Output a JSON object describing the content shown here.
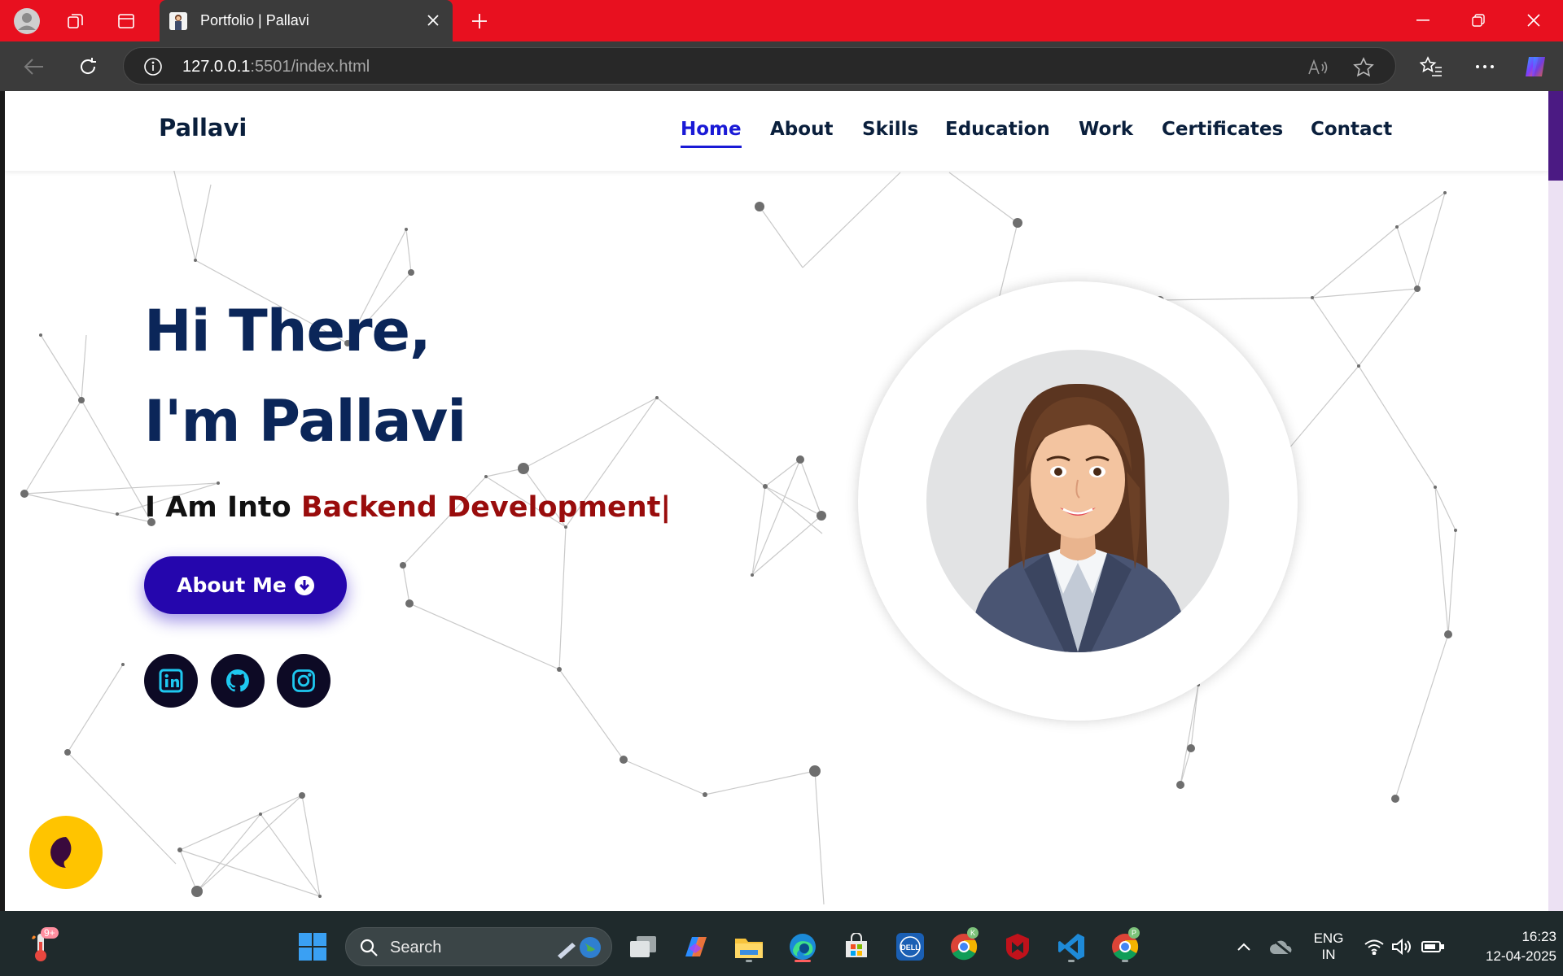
{
  "browser": {
    "tab_title": "Portfolio | Pallavi",
    "url_host": "127.0.0.1",
    "url_rest": ":5501/index.html"
  },
  "site": {
    "logo": "Pallavi",
    "nav": [
      "Home",
      "About",
      "Skills",
      "Education",
      "Work",
      "Certificates",
      "Contact"
    ],
    "active_nav": "Home",
    "hero_line1": "Hi There,",
    "hero_line2": "I'm Pallavi",
    "sub_prefix": "I Am Into ",
    "sub_typed": "Backend Development|",
    "about_button": "About Me",
    "socials": [
      "linkedin-icon",
      "github-icon",
      "instagram-icon"
    ]
  },
  "taskbar": {
    "search_placeholder": "Search",
    "weather_badge": "9+",
    "lang_line1": "ENG",
    "lang_line2": "IN",
    "time": "16:23",
    "date": "12-04-2025",
    "chrome_badge_k": "K",
    "chrome_badge_p": "P"
  },
  "colors": {
    "titlebar": "#e8101f",
    "navy": "#0b2659",
    "accent_blue": "#2506ad",
    "typed_red": "#990c0c",
    "chat_yellow": "#ffc400"
  }
}
